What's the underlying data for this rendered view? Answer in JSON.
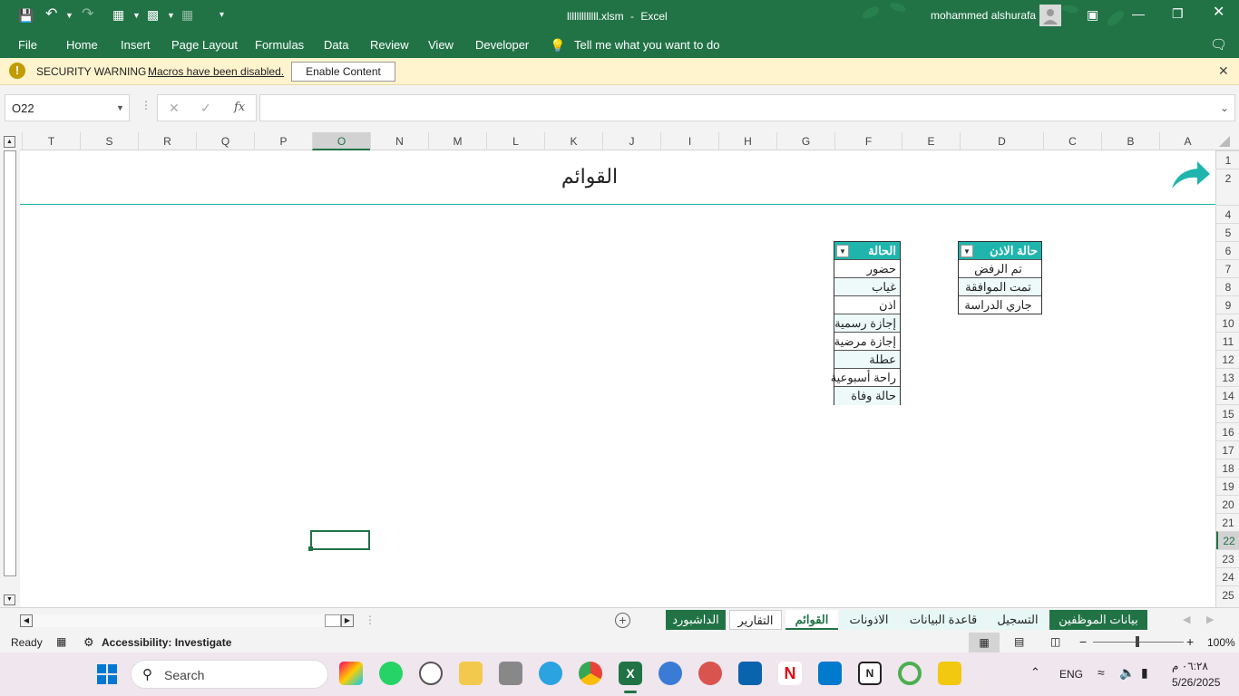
{
  "window": {
    "filename": "lllllllllllll.xlsm",
    "app": "Excel",
    "separator": "-",
    "user": "mohammed alshurafa"
  },
  "ribbon_tabs": [
    "File",
    "Home",
    "Insert",
    "Page Layout",
    "Formulas",
    "Data",
    "Review",
    "View",
    "Developer"
  ],
  "tell_me": "Tell me what you want to do",
  "security": {
    "title": "SECURITY WARNING",
    "message": "Macros have been disabled.",
    "button": "Enable Content"
  },
  "formula_bar": {
    "name_box": "O22",
    "fx": "fx",
    "value": ""
  },
  "columns": [
    "T",
    "S",
    "R",
    "Q",
    "P",
    "O",
    "N",
    "M",
    "L",
    "K",
    "J",
    "I",
    "H",
    "G",
    "F",
    "E",
    "D",
    "C",
    "B",
    "A"
  ],
  "rows": [
    "1",
    "2",
    "4",
    "5",
    "6",
    "7",
    "8",
    "9",
    "10",
    "11",
    "12",
    "13",
    "14",
    "15",
    "16",
    "17",
    "18",
    "19",
    "20",
    "21",
    "22",
    "23",
    "24",
    "25"
  ],
  "sheet": {
    "title": "القوائم",
    "status_table": {
      "header": "الحالة",
      "items": [
        "حضور",
        "غياب",
        "اذن",
        "إجازة رسمية",
        "إجازة مرضية",
        "عطلة",
        "راحة أسبوعية",
        "حالة وفاة"
      ]
    },
    "permission_table": {
      "header": "حالة الاذن",
      "items": [
        "تم الرفض",
        "تمت الموافقة",
        "جاري الدراسة"
      ]
    }
  },
  "sheet_tabs": [
    "بيانات الموظفين",
    "التسجيل",
    "قاعدة البيانات",
    "الاذونات",
    "القوائم",
    "التقارير",
    "الداشبورد"
  ],
  "active_tab": "القوائم",
  "status_bar": {
    "ready": "Ready",
    "accessibility": "Accessibility: Investigate",
    "zoom": "100%"
  },
  "taskbar": {
    "search": "Search",
    "lang": "ENG",
    "time": "٠٦:٢٨ م",
    "date": "5/26/2025"
  },
  "colors": {
    "excel_green": "#217346",
    "teal": "#1fb5ad",
    "warning_bg": "#fff4ce"
  }
}
